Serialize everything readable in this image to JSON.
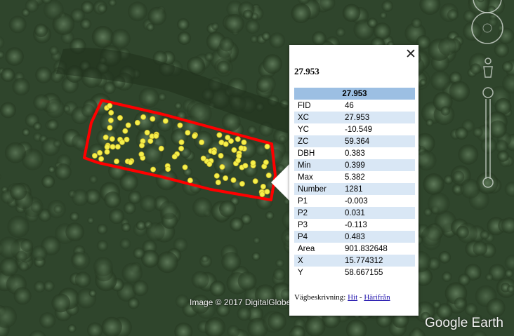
{
  "map": {
    "attribution": "Image © 2017 DigitalGlobe",
    "logo": "Google Earth"
  },
  "balloon": {
    "title": "27.953",
    "table_header": "27.953",
    "rows": [
      {
        "key": "FID",
        "value": "46"
      },
      {
        "key": "XC",
        "value": "27.953"
      },
      {
        "key": "YC",
        "value": "-10.549"
      },
      {
        "key": "ZC",
        "value": "59.364"
      },
      {
        "key": "DBH",
        "value": "0.383"
      },
      {
        "key": "Min",
        "value": "0.399"
      },
      {
        "key": "Max",
        "value": "5.382"
      },
      {
        "key": "Number",
        "value": "1281"
      },
      {
        "key": "P1",
        "value": "-0.003"
      },
      {
        "key": "P2",
        "value": "0.031"
      },
      {
        "key": "P3",
        "value": "-0.113"
      },
      {
        "key": "P4",
        "value": "0.483"
      },
      {
        "key": "Area",
        "value": "901.832648"
      },
      {
        "key": "X",
        "value": "15.774312"
      },
      {
        "key": "Y",
        "value": "58.667155"
      }
    ],
    "directions": {
      "label": "Vägbeskrivning:",
      "to_here": "Hit",
      "separator": "-",
      "from_here": "Härifrån"
    },
    "close_icon": "close-icon"
  },
  "colors": {
    "polygon_outline": "#ff0000",
    "tree_markers": "#f5f04a",
    "table_header_bg": "#9cbfe3",
    "table_alt_row_bg": "#d9e7f5"
  }
}
